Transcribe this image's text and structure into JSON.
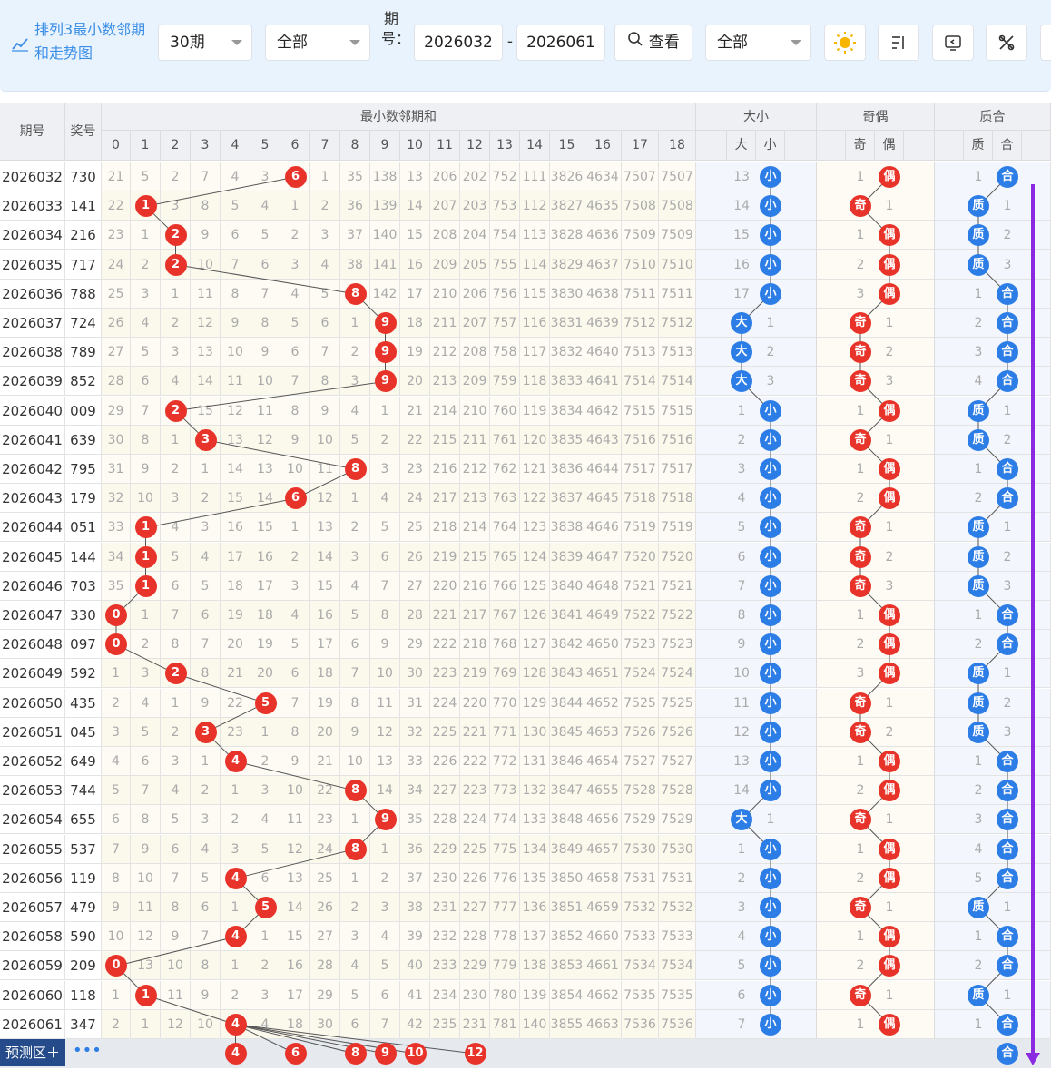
{
  "toolbar": {
    "title": "排列3最小数邻期和走势图",
    "period_select": "30期",
    "filter1_select": "全部",
    "issue_label": "期号：",
    "issue_from": "2026032",
    "range_dash": "-",
    "issue_to": "2026061",
    "query_label": "查看",
    "filter2_select": "全部",
    "icons": [
      "sun-icon",
      "sort-icon",
      "screen-icon",
      "tools-icon"
    ]
  },
  "headers": {
    "issue": "期号",
    "prize": "奖号",
    "min_group": "最小数邻期和",
    "size_group": "大小",
    "parity_group": "奇偶",
    "prime_group": "质合",
    "sub_cols": [
      "0",
      "1",
      "2",
      "3",
      "4",
      "5",
      "6",
      "7",
      "8",
      "9",
      "10",
      "11",
      "12",
      "13",
      "14",
      "15",
      "16",
      "17",
      "18"
    ],
    "size_cols": [
      "大",
      "小"
    ],
    "parity_cols": [
      "奇",
      "偶"
    ],
    "prime_cols": [
      "质",
      "合"
    ]
  },
  "labels": {
    "big": "大",
    "small": "小",
    "odd": "奇",
    "even": "偶",
    "prime": "质",
    "composite": "合"
  },
  "rows": [
    {
      "issue": "2026032",
      "prize": "730",
      "vals": [
        21,
        5,
        2,
        7,
        4,
        3,
        null,
        1,
        35,
        138,
        13,
        206,
        202,
        752,
        111,
        3826,
        4634,
        7507,
        7507
      ],
      "hit": 6,
      "size": [
        "13",
        "小"
      ],
      "parity": [
        "1",
        "偶"
      ],
      "prime": [
        "1",
        "合"
      ]
    },
    {
      "issue": "2026033",
      "prize": "141",
      "vals": [
        22,
        null,
        3,
        8,
        5,
        4,
        1,
        2,
        36,
        139,
        14,
        207,
        203,
        753,
        112,
        3827,
        4635,
        7508,
        7508
      ],
      "hit": 1,
      "size": [
        "14",
        "小"
      ],
      "parity": [
        "奇",
        "1"
      ],
      "prime": [
        "质",
        "1"
      ]
    },
    {
      "issue": "2026034",
      "prize": "216",
      "vals": [
        23,
        1,
        null,
        9,
        6,
        5,
        2,
        3,
        37,
        140,
        15,
        208,
        204,
        754,
        113,
        3828,
        4636,
        7509,
        7509
      ],
      "hit": 2,
      "size": [
        "15",
        "小"
      ],
      "parity": [
        "1",
        "偶"
      ],
      "prime": [
        "质",
        "2"
      ]
    },
    {
      "issue": "2026035",
      "prize": "717",
      "vals": [
        24,
        2,
        null,
        10,
        7,
        6,
        3,
        4,
        38,
        141,
        16,
        209,
        205,
        755,
        114,
        3829,
        4637,
        7510,
        7510
      ],
      "hit": 2,
      "size": [
        "16",
        "小"
      ],
      "parity": [
        "2",
        "偶"
      ],
      "prime": [
        "质",
        "3"
      ]
    },
    {
      "issue": "2026036",
      "prize": "788",
      "vals": [
        25,
        3,
        1,
        11,
        8,
        7,
        4,
        5,
        null,
        142,
        17,
        210,
        206,
        756,
        115,
        3830,
        4638,
        7511,
        7511
      ],
      "hit": 8,
      "size": [
        "17",
        "小"
      ],
      "parity": [
        "3",
        "偶"
      ],
      "prime": [
        "1",
        "合"
      ]
    },
    {
      "issue": "2026037",
      "prize": "724",
      "vals": [
        26,
        4,
        2,
        12,
        9,
        8,
        5,
        6,
        1,
        null,
        18,
        211,
        207,
        757,
        116,
        3831,
        4639,
        7512,
        7512
      ],
      "hit": 9,
      "size": [
        "大",
        "1"
      ],
      "parity": [
        "奇",
        "1"
      ],
      "prime": [
        "2",
        "合"
      ]
    },
    {
      "issue": "2026038",
      "prize": "789",
      "vals": [
        27,
        5,
        3,
        13,
        10,
        9,
        6,
        7,
        2,
        null,
        19,
        212,
        208,
        758,
        117,
        3832,
        4640,
        7513,
        7513
      ],
      "hit": 9,
      "size": [
        "大",
        "2"
      ],
      "parity": [
        "奇",
        "2"
      ],
      "prime": [
        "3",
        "合"
      ]
    },
    {
      "issue": "2026039",
      "prize": "852",
      "vals": [
        28,
        6,
        4,
        14,
        11,
        10,
        7,
        8,
        3,
        null,
        20,
        213,
        209,
        759,
        118,
        3833,
        4641,
        7514,
        7514
      ],
      "hit": 9,
      "size": [
        "大",
        "3"
      ],
      "parity": [
        "奇",
        "3"
      ],
      "prime": [
        "4",
        "合"
      ]
    },
    {
      "issue": "2026040",
      "prize": "009",
      "vals": [
        29,
        7,
        null,
        15,
        12,
        11,
        8,
        9,
        4,
        1,
        21,
        214,
        210,
        760,
        119,
        3834,
        4642,
        7515,
        7515
      ],
      "hit": 2,
      "size": [
        "1",
        "小"
      ],
      "parity": [
        "1",
        "偶"
      ],
      "prime": [
        "质",
        "1"
      ]
    },
    {
      "issue": "2026041",
      "prize": "639",
      "vals": [
        30,
        8,
        1,
        null,
        13,
        12,
        9,
        10,
        5,
        2,
        22,
        215,
        211,
        761,
        120,
        3835,
        4643,
        7516,
        7516
      ],
      "hit": 3,
      "size": [
        "2",
        "小"
      ],
      "parity": [
        "奇",
        "1"
      ],
      "prime": [
        "质",
        "2"
      ]
    },
    {
      "issue": "2026042",
      "prize": "795",
      "vals": [
        31,
        9,
        2,
        1,
        14,
        13,
        10,
        11,
        null,
        3,
        23,
        216,
        212,
        762,
        121,
        3836,
        4644,
        7517,
        7517
      ],
      "hit": 8,
      "size": [
        "3",
        "小"
      ],
      "parity": [
        "1",
        "偶"
      ],
      "prime": [
        "1",
        "合"
      ]
    },
    {
      "issue": "2026043",
      "prize": "179",
      "vals": [
        32,
        10,
        3,
        2,
        15,
        14,
        null,
        12,
        1,
        4,
        24,
        217,
        213,
        763,
        122,
        3837,
        4645,
        7518,
        7518
      ],
      "hit": 6,
      "size": [
        "4",
        "小"
      ],
      "parity": [
        "2",
        "偶"
      ],
      "prime": [
        "2",
        "合"
      ]
    },
    {
      "issue": "2026044",
      "prize": "051",
      "vals": [
        33,
        null,
        4,
        3,
        16,
        15,
        1,
        13,
        2,
        5,
        25,
        218,
        214,
        764,
        123,
        3838,
        4646,
        7519,
        7519
      ],
      "hit": 1,
      "size": [
        "5",
        "小"
      ],
      "parity": [
        "奇",
        "1"
      ],
      "prime": [
        "质",
        "1"
      ]
    },
    {
      "issue": "2026045",
      "prize": "144",
      "vals": [
        34,
        null,
        5,
        4,
        17,
        16,
        2,
        14,
        3,
        6,
        26,
        219,
        215,
        765,
        124,
        3839,
        4647,
        7520,
        7520
      ],
      "hit": 1,
      "size": [
        "6",
        "小"
      ],
      "parity": [
        "奇",
        "2"
      ],
      "prime": [
        "质",
        "2"
      ]
    },
    {
      "issue": "2026046",
      "prize": "703",
      "vals": [
        35,
        null,
        6,
        5,
        18,
        17,
        3,
        15,
        4,
        7,
        27,
        220,
        216,
        766,
        125,
        3840,
        4648,
        7521,
        7521
      ],
      "hit": 1,
      "size": [
        "7",
        "小"
      ],
      "parity": [
        "奇",
        "3"
      ],
      "prime": [
        "质",
        "3"
      ]
    },
    {
      "issue": "2026047",
      "prize": "330",
      "vals": [
        null,
        1,
        7,
        6,
        19,
        18,
        4,
        16,
        5,
        8,
        28,
        221,
        217,
        767,
        126,
        3841,
        4649,
        7522,
        7522
      ],
      "hit": 0,
      "size": [
        "8",
        "小"
      ],
      "parity": [
        "1",
        "偶"
      ],
      "prime": [
        "1",
        "合"
      ]
    },
    {
      "issue": "2026048",
      "prize": "097",
      "vals": [
        null,
        2,
        8,
        7,
        20,
        19,
        5,
        17,
        6,
        9,
        29,
        222,
        218,
        768,
        127,
        3842,
        4650,
        7523,
        7523
      ],
      "hit": 0,
      "size": [
        "9",
        "小"
      ],
      "parity": [
        "2",
        "偶"
      ],
      "prime": [
        "2",
        "合"
      ]
    },
    {
      "issue": "2026049",
      "prize": "592",
      "vals": [
        1,
        3,
        null,
        8,
        21,
        20,
        6,
        18,
        7,
        10,
        30,
        223,
        219,
        769,
        128,
        3843,
        4651,
        7524,
        7524
      ],
      "hit": 2,
      "size": [
        "10",
        "小"
      ],
      "parity": [
        "3",
        "偶"
      ],
      "prime": [
        "质",
        "1"
      ]
    },
    {
      "issue": "2026050",
      "prize": "435",
      "vals": [
        2,
        4,
        1,
        9,
        22,
        null,
        7,
        19,
        8,
        11,
        31,
        224,
        220,
        770,
        129,
        3844,
        4652,
        7525,
        7525
      ],
      "hit": 5,
      "size": [
        "11",
        "小"
      ],
      "parity": [
        "奇",
        "1"
      ],
      "prime": [
        "质",
        "2"
      ]
    },
    {
      "issue": "2026051",
      "prize": "045",
      "vals": [
        3,
        5,
        2,
        null,
        23,
        1,
        8,
        20,
        9,
        12,
        32,
        225,
        221,
        771,
        130,
        3845,
        4653,
        7526,
        7526
      ],
      "hit": 3,
      "size": [
        "12",
        "小"
      ],
      "parity": [
        "奇",
        "2"
      ],
      "prime": [
        "质",
        "3"
      ]
    },
    {
      "issue": "2026052",
      "prize": "649",
      "vals": [
        4,
        6,
        3,
        1,
        null,
        2,
        9,
        21,
        10,
        13,
        33,
        226,
        222,
        772,
        131,
        3846,
        4654,
        7527,
        7527
      ],
      "hit": 4,
      "size": [
        "13",
        "小"
      ],
      "parity": [
        "1",
        "偶"
      ],
      "prime": [
        "1",
        "合"
      ]
    },
    {
      "issue": "2026053",
      "prize": "744",
      "vals": [
        5,
        7,
        4,
        2,
        1,
        3,
        10,
        22,
        null,
        14,
        34,
        227,
        223,
        773,
        132,
        3847,
        4655,
        7528,
        7528
      ],
      "hit": 8,
      "size": [
        "14",
        "小"
      ],
      "parity": [
        "2",
        "偶"
      ],
      "prime": [
        "2",
        "合"
      ]
    },
    {
      "issue": "2026054",
      "prize": "655",
      "vals": [
        6,
        8,
        5,
        3,
        2,
        4,
        11,
        23,
        1,
        null,
        35,
        228,
        224,
        774,
        133,
        3848,
        4656,
        7529,
        7529
      ],
      "hit": 9,
      "size": [
        "大",
        "1"
      ],
      "parity": [
        "奇",
        "1"
      ],
      "prime": [
        "3",
        "合"
      ]
    },
    {
      "issue": "2026055",
      "prize": "537",
      "vals": [
        7,
        9,
        6,
        4,
        3,
        5,
        12,
        24,
        null,
        1,
        36,
        229,
        225,
        775,
        134,
        3849,
        4657,
        7530,
        7530
      ],
      "hit": 8,
      "size": [
        "1",
        "小"
      ],
      "parity": [
        "1",
        "偶"
      ],
      "prime": [
        "4",
        "合"
      ]
    },
    {
      "issue": "2026056",
      "prize": "119",
      "vals": [
        8,
        10,
        7,
        5,
        null,
        6,
        13,
        25,
        1,
        2,
        37,
        230,
        226,
        776,
        135,
        3850,
        4658,
        7531,
        7531
      ],
      "hit": 4,
      "size": [
        "2",
        "小"
      ],
      "parity": [
        "2",
        "偶"
      ],
      "prime": [
        "5",
        "合"
      ]
    },
    {
      "issue": "2026057",
      "prize": "479",
      "vals": [
        9,
        11,
        8,
        6,
        1,
        null,
        14,
        26,
        2,
        3,
        38,
        231,
        227,
        777,
        136,
        3851,
        4659,
        7532,
        7532
      ],
      "hit": 5,
      "size": [
        "3",
        "小"
      ],
      "parity": [
        "奇",
        "1"
      ],
      "prime": [
        "质",
        "1"
      ]
    },
    {
      "issue": "2026058",
      "prize": "590",
      "vals": [
        10,
        12,
        9,
        7,
        null,
        1,
        15,
        27,
        3,
        4,
        39,
        232,
        228,
        778,
        137,
        3852,
        4660,
        7533,
        7533
      ],
      "hit": 4,
      "size": [
        "4",
        "小"
      ],
      "parity": [
        "1",
        "偶"
      ],
      "prime": [
        "1",
        "合"
      ]
    },
    {
      "issue": "2026059",
      "prize": "209",
      "vals": [
        null,
        13,
        10,
        8,
        1,
        2,
        16,
        28,
        4,
        5,
        40,
        233,
        229,
        779,
        138,
        3853,
        4661,
        7534,
        7534
      ],
      "hit": 0,
      "size": [
        "5",
        "小"
      ],
      "parity": [
        "2",
        "偶"
      ],
      "prime": [
        "2",
        "合"
      ]
    },
    {
      "issue": "2026060",
      "prize": "118",
      "vals": [
        1,
        null,
        11,
        9,
        2,
        3,
        17,
        29,
        5,
        6,
        41,
        234,
        230,
        780,
        139,
        3854,
        4662,
        7535,
        7535
      ],
      "hit": 1,
      "size": [
        "6",
        "小"
      ],
      "parity": [
        "奇",
        "1"
      ],
      "prime": [
        "质",
        "1"
      ]
    },
    {
      "issue": "2026061",
      "prize": "347",
      "vals": [
        2,
        1,
        12,
        10,
        null,
        4,
        18,
        30,
        6,
        7,
        42,
        235,
        231,
        781,
        140,
        3855,
        4663,
        7536,
        7536
      ],
      "hit": 4,
      "size": [
        "7",
        "小"
      ],
      "parity": [
        "1",
        "偶"
      ],
      "prime": [
        "1",
        "合"
      ]
    }
  ],
  "predict": {
    "label": "预测区＋",
    "dots": "•••",
    "balls": [
      "4",
      "6",
      "8",
      "9",
      "10",
      "12"
    ],
    "prime_ball": "合"
  },
  "colors": {
    "red": "#e8332a",
    "blue": "#2d7de6",
    "purple_arrow": "#8a2be2"
  }
}
